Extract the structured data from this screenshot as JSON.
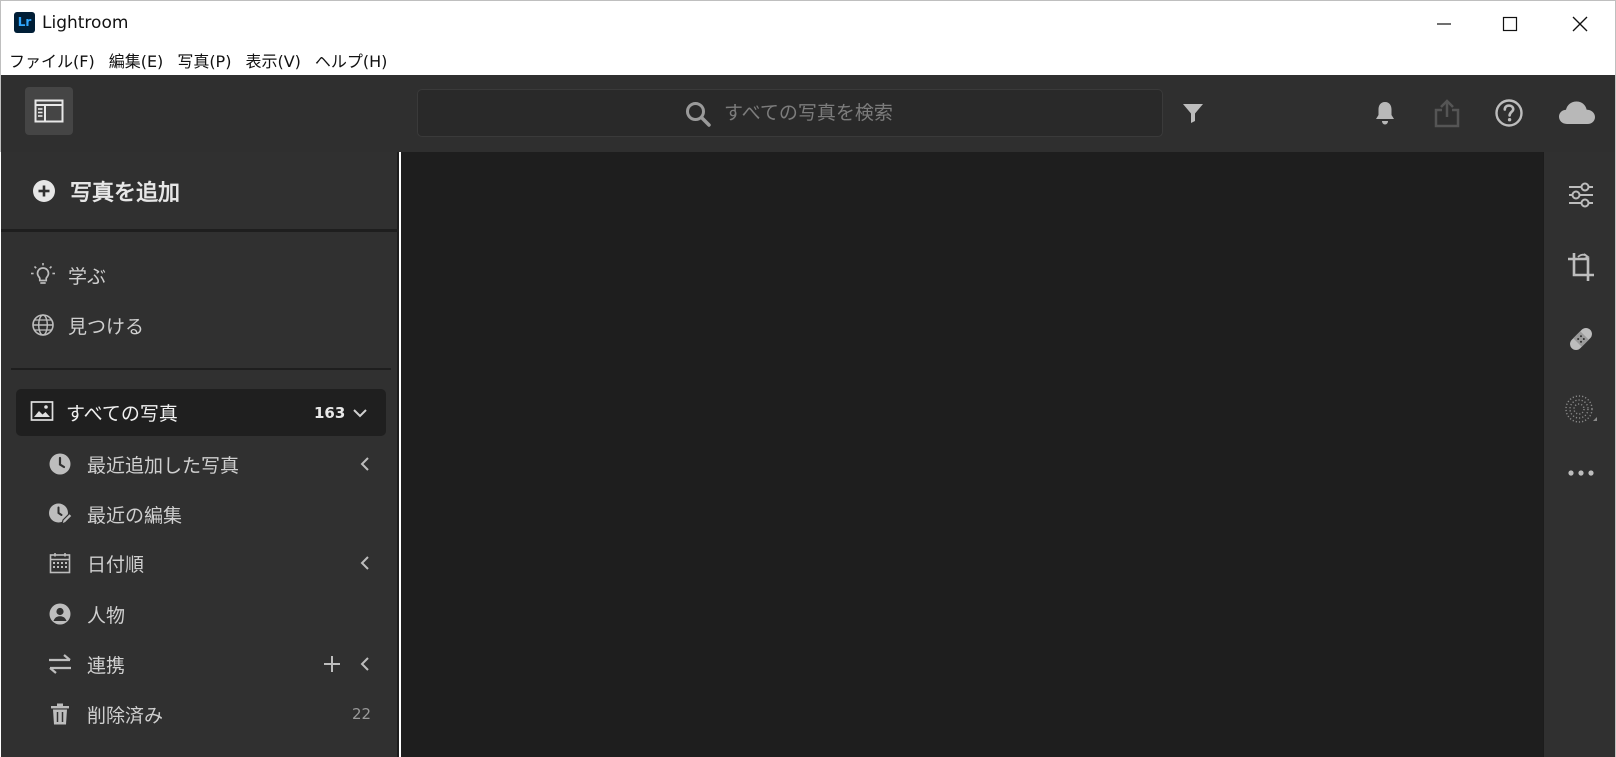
{
  "window": {
    "app_logo_text": "Lr",
    "title": "Lightroom"
  },
  "menubar": {
    "items": [
      "ファイル(F)",
      "編集(E)",
      "写真(P)",
      "表示(V)",
      "ヘルプ(H)"
    ]
  },
  "toolbar": {
    "search_placeholder": "すべての写真を検索"
  },
  "left_panel": {
    "add_photo_label": "写真を追加",
    "learn_label": "学ぶ",
    "discover_label": "見つける",
    "all_photos": {
      "label": "すべての写真",
      "count": "163"
    },
    "items": [
      {
        "label": "最近追加した写真",
        "icon": "clock-icon"
      },
      {
        "label": "最近の編集",
        "icon": "recent-edit-icon"
      },
      {
        "label": "日付順",
        "icon": "calendar-icon"
      },
      {
        "label": "人物",
        "icon": "person-icon"
      },
      {
        "label": "連携",
        "icon": "sync-arrows-icon"
      },
      {
        "label": "削除済み",
        "icon": "trash-icon",
        "count": "22"
      }
    ]
  },
  "colors": {
    "toolbar_bg": "#2f2f2f",
    "panel_bg": "#303030",
    "canvas_bg": "#1e1e1e",
    "selected_bg": "#1f1f1f",
    "lr_blue": "#31a8ff"
  }
}
